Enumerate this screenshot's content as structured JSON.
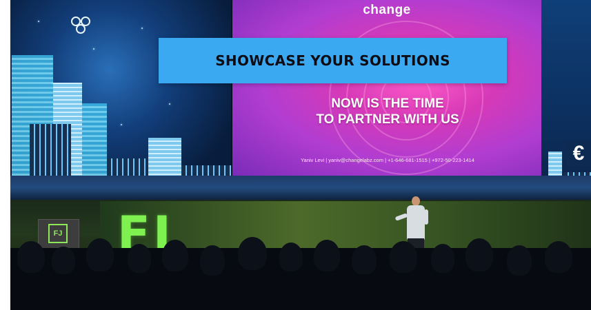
{
  "banner": {
    "title": "SHOWCASE YOUR SOLUTIONS"
  },
  "screen": {
    "brand": "change",
    "headline_line1": "NOW IS THE TIME",
    "headline_line2": "TO PARTNER WITH US",
    "contact": "Yaniv Levi | yaniv@changelabz.com | +1-646-681-1515 | +972-50-223-1414"
  },
  "stage": {
    "logo": "FJ",
    "lectern_logo": "FJ"
  },
  "icons": {
    "currency": "€",
    "people": "people-icon"
  },
  "colors": {
    "banner_bg": "#3aa9f1",
    "screen_pink": "#d639b7",
    "stage_green": "#7ef050"
  }
}
